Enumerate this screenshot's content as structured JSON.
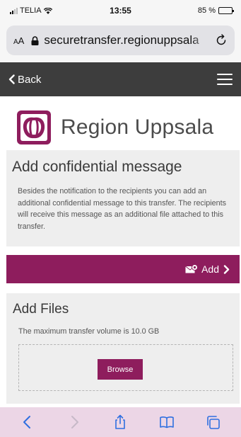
{
  "status_bar": {
    "carrier": "TELIA",
    "time": "13:55",
    "battery_percent": "85 %",
    "battery_level": 0.85
  },
  "browser": {
    "text_size_label": "AA",
    "url": "securetransfer.regionuppsala"
  },
  "nav": {
    "back_label": "Back",
    "menu_icon": "hamburger-menu-icon"
  },
  "logo": {
    "name": "Region Uppsala",
    "color": "#8e1d5d"
  },
  "confidential": {
    "title": "Add confidential message",
    "description": "Besides the notification to the recipients you can add an additional confidential message to this transfer. The recipients will receive this message as an additional file attached to this transfer.",
    "add_label": "Add"
  },
  "files": {
    "title": "Add Files",
    "max_volume": "The maximum transfer volume is 10.0 GB",
    "browse_label": "Browse"
  },
  "toolbar": {
    "items": [
      "back-icon",
      "forward-icon",
      "share-icon",
      "bookmarks-icon",
      "tabs-icon"
    ]
  },
  "colors": {
    "brand": "#8e1d5d",
    "nav": "#3d3d3d",
    "section_bg": "#eeeeee"
  }
}
